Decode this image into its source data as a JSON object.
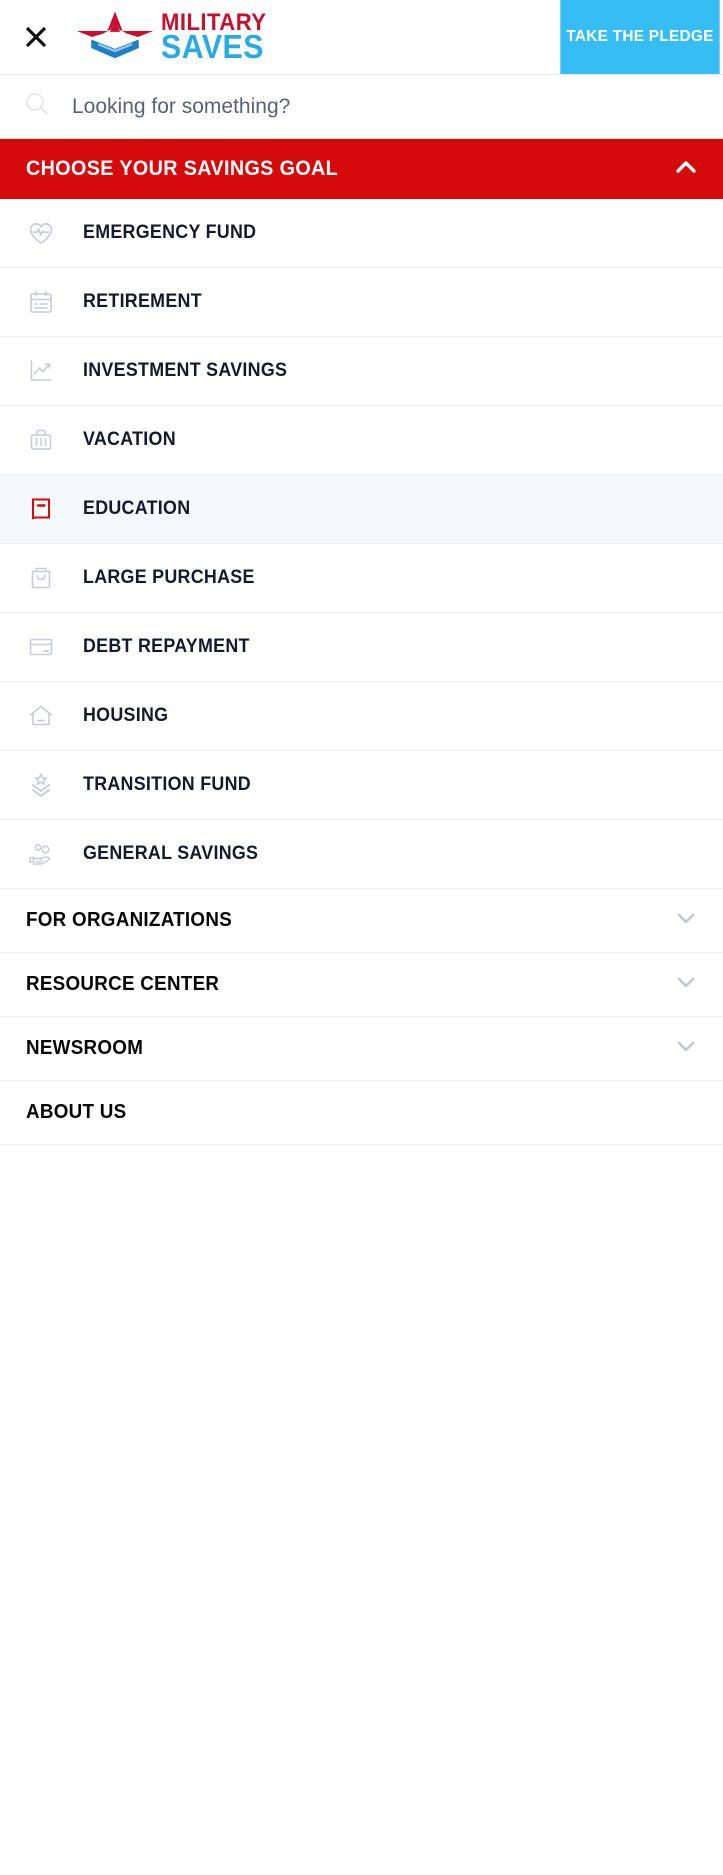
{
  "header": {
    "close_icon": "close-icon",
    "logo": {
      "mark": "military-saves-star-chevron-logo",
      "line1": "MILITARY",
      "line2": "SAVES",
      "line1_color": "#c8102e",
      "line2_color": "#29abe2"
    },
    "pledge_button": {
      "label": "TAKE THE PLEDGE",
      "bg_color": "#36bdf4",
      "text_color": "#ffffff"
    }
  },
  "search": {
    "icon": "search-icon",
    "placeholder": "Looking for something?",
    "value": ""
  },
  "goal_section": {
    "title": "CHOOSE YOUR SAVINGS GOAL",
    "bg_color": "#d50a0a",
    "expanded": true,
    "toggle_icon": "chevron-up-icon",
    "items": [
      {
        "label": "EMERGENCY FUND",
        "icon": "heart-pulse-icon",
        "active": false
      },
      {
        "label": "RETIREMENT",
        "icon": "calendar-icon",
        "active": false
      },
      {
        "label": "INVESTMENT SAVINGS",
        "icon": "line-chart-icon",
        "active": false
      },
      {
        "label": "VACATION",
        "icon": "suitcase-icon",
        "active": false
      },
      {
        "label": "EDUCATION",
        "icon": "book-icon",
        "active": true
      },
      {
        "label": "LARGE PURCHASE",
        "icon": "shopping-bag-icon",
        "active": false
      },
      {
        "label": "DEBT REPAYMENT",
        "icon": "credit-card-icon",
        "active": false
      },
      {
        "label": "HOUSING",
        "icon": "house-icon",
        "active": false
      },
      {
        "label": "TRANSITION FUND",
        "icon": "military-rank-icon",
        "active": false
      },
      {
        "label": "GENERAL SAVINGS",
        "icon": "hand-coins-icon",
        "active": false
      }
    ],
    "active_color": "#d50a0a",
    "active_row_bg": "#f6f9fb"
  },
  "sections": [
    {
      "label": "FOR ORGANIZATIONS",
      "has_chevron": true,
      "toggle_icon": "chevron-down-icon"
    },
    {
      "label": "RESOURCE CENTER",
      "has_chevron": true,
      "toggle_icon": "chevron-down-icon"
    },
    {
      "label": "NEWSROOM",
      "has_chevron": true,
      "toggle_icon": "chevron-down-icon"
    },
    {
      "label": "ABOUT US",
      "has_chevron": false,
      "toggle_icon": ""
    }
  ]
}
